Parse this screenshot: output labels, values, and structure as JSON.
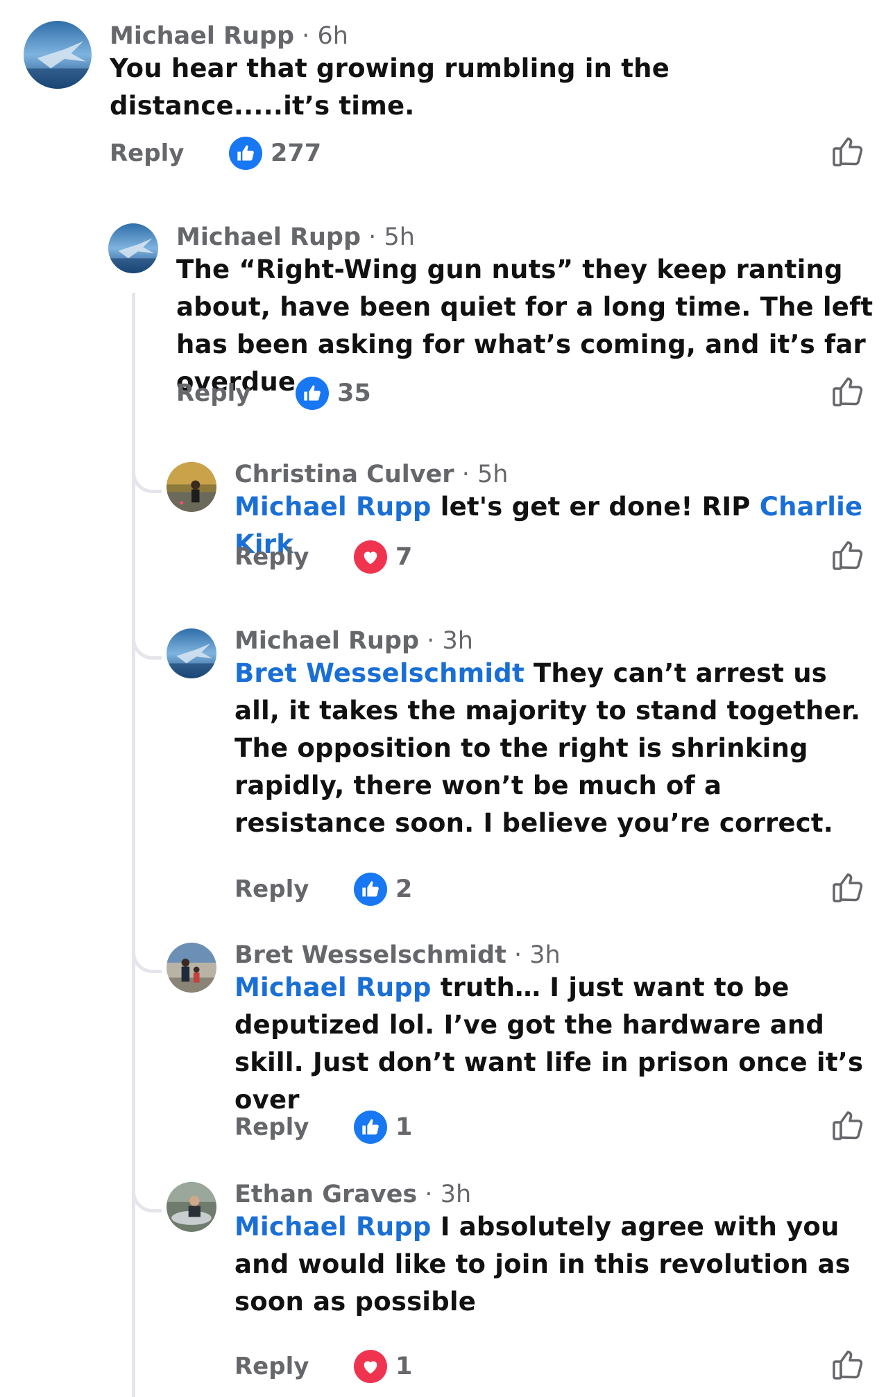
{
  "comments": [
    {
      "name": "Michael Rupp",
      "separator": "·",
      "time": "6h",
      "mention": "",
      "text": "You hear that growing rumbling in the distance.....it’s time.",
      "reply_label": "Reply",
      "reaction": "like",
      "reaction_count": "277"
    },
    {
      "name": "Michael Rupp",
      "separator": "·",
      "time": "5h",
      "mention": "",
      "text": "The “Right-Wing gun nuts” they keep ranting about, have been quiet for a long time. The left has been asking for what’s coming, and it’s far overdue.",
      "reply_label": "Reply",
      "reaction": "like",
      "reaction_count": "35"
    },
    {
      "name": "Christina Culver",
      "separator": "·",
      "time": "5h",
      "mention": "Michael Rupp",
      "text": " let's get er done! RIP ",
      "mention2": "Charlie Kirk",
      "reply_label": "Reply",
      "reaction": "love",
      "reaction_count": "7"
    },
    {
      "name": "Michael Rupp",
      "separator": "·",
      "time": "3h",
      "mention": "Bret Wesselschmidt",
      "text": " They can’t arrest us all, it takes the majority to stand together. The opposition to the right is shrinking rapidly, there won’t be much of a resistance soon. I believe you’re correct.",
      "reply_label": "Reply",
      "reaction": "like",
      "reaction_count": "2"
    },
    {
      "name": "Bret Wesselschmidt",
      "separator": "·",
      "time": "3h",
      "mention": "Michael Rupp",
      "text": " truth… I just want to be deputized lol. I’ve got the hardware and skill. Just don’t want life in prison once it’s over",
      "reply_label": "Reply",
      "reaction": "like",
      "reaction_count": "1"
    },
    {
      "name": "Ethan Graves",
      "separator": "·",
      "time": "3h",
      "mention": "Michael Rupp",
      "text": " I absolutely agree with you and would like to join in this revolution as soon as possible",
      "reply_label": "Reply",
      "reaction": "love",
      "reaction_count": "1"
    }
  ],
  "icons": {
    "like_reaction": "thumbs-up-icon",
    "love_reaction": "heart-icon",
    "like_button": "thumbs-up-outline-icon"
  },
  "colors": {
    "mention": "#1a6fd6",
    "like_blue": "#1877f2",
    "love_red": "#f0344f",
    "secondary_text": "#65676b",
    "thread_line": "#e4e6eb"
  }
}
